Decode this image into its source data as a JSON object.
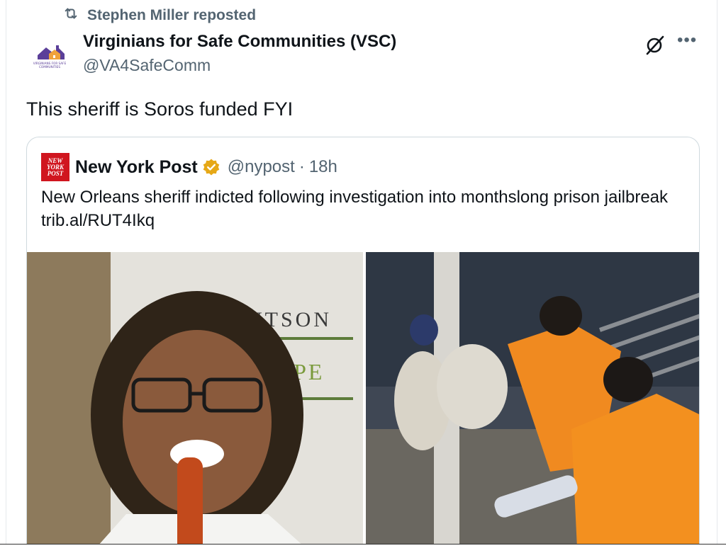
{
  "repost": {
    "label": "Stephen Miller reposted"
  },
  "author": {
    "name": "Virginians for Safe Communities (VSC)",
    "handle": "@VA4SafeComm",
    "avatar_text_1": "VIRGINIANS FOR SAFE",
    "avatar_text_2": "COMMUNITIES"
  },
  "post": {
    "text": "This sheriff is Soros funded FYI"
  },
  "quote": {
    "logo_lines": [
      "NEW",
      "YORK",
      "POST"
    ],
    "name": "New York Post",
    "handle": "@nypost",
    "separator": "·",
    "time": "18h",
    "text": "New Orleans sheriff indicted following investigation into monthslong prison jailbreak trib.al/RUT4Ikq",
    "media_left_sign_1": "UTSON",
    "media_left_sign_2": "OPE"
  },
  "colors": {
    "accent_verified": "#e6a817",
    "nypost_red": "#d0161f",
    "secondary_text": "#536471",
    "avatar_purple": "#5b3f99"
  },
  "icons": {
    "repost": "repost-icon",
    "grok": "grok-icon",
    "more": "more-icon",
    "verified": "verified-badge-icon"
  }
}
